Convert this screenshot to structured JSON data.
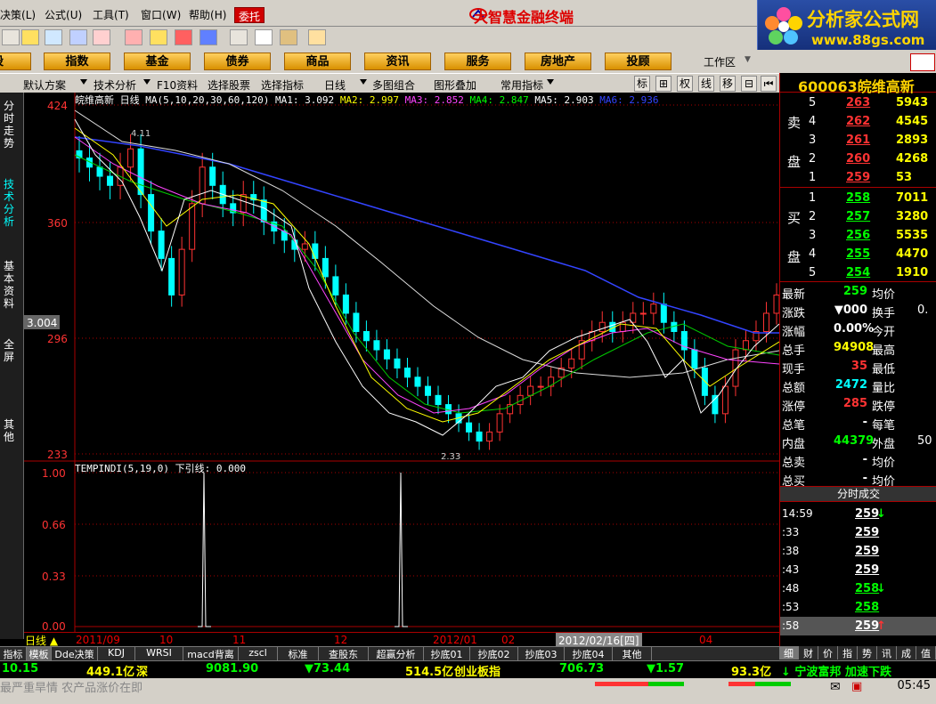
{
  "menu": {
    "items": [
      "决策",
      "公式",
      "工具",
      "窗口",
      "帮助"
    ],
    "shortcuts": [
      "(L)",
      "(U)",
      "(T)",
      "(W)",
      "(H)"
    ],
    "entrust": "委托",
    "app_title": "大智慧金融终端"
  },
  "brand": {
    "name": "分析家公式网",
    "url": "www.88gs.com"
  },
  "categories": [
    "股",
    "指数",
    "基金",
    "债券",
    "商品",
    "资讯",
    "服务",
    "房地产",
    "投顾"
  ],
  "workspace": "工作区",
  "chartbar": {
    "items": [
      "默认方案",
      "技术分析",
      "F10资料",
      "选择股票",
      "选择指标",
      "日线",
      "多图组合",
      "图形叠加",
      "常用指标"
    ],
    "buttons": [
      "标",
      "⊞",
      "权",
      "线",
      "移",
      "⊟",
      "⏮"
    ]
  },
  "sidetabs": [
    "分时走势",
    "技术分析",
    "基本资料",
    "全屏",
    "其他"
  ],
  "stock": {
    "code": "600063",
    "name": "皖维高新"
  },
  "kinfo": {
    "name": "皖维高新",
    "period": "日线",
    "ma": "MA(5,10,20,30,60,120)",
    "ma1": "MA1: 3.092",
    "ma2": "MA2: 2.997",
    "ma3": "MA3: 2.852",
    "ma4": "MA4: 2.847",
    "ma5": "MA5: 2.903",
    "ma6": "MA6: 2.936"
  },
  "colors": {
    "ma1": "#ffffff",
    "ma2": "#ffff00",
    "ma3": "#ff44ff",
    "ma4": "#00ff00",
    "ma5": "#ffffff",
    "ma6": "#3344ff",
    "up": "#ff3333",
    "down": "#00ffff",
    "grid": "#aa0000",
    "axis_label": "#ff3333"
  },
  "price_axis": {
    "labels": [
      "424",
      "360",
      "296",
      "233"
    ],
    "cursor_price": "3.004",
    "high_mark": "4.11",
    "low_mark": "2.33"
  },
  "indicator": {
    "title": "TEMPINDI(5,19,0)",
    "value": "下引线: 0.000",
    "axis_labels": [
      "1.00",
      "0.66",
      "0.33",
      "0.00"
    ]
  },
  "time_axis": {
    "period_label": "日线",
    "labels": [
      "2011/09",
      "10",
      "11",
      "12",
      "2012/01",
      "02",
      "04"
    ],
    "cursor_date": "2012/02/16[四]"
  },
  "indtabs": [
    "指标",
    "模板",
    "Dde决策",
    "KDJ",
    "WRSI",
    "macd背离",
    "zscl",
    "标准",
    "查股东",
    "超赢分析",
    "抄底01",
    "抄底02",
    "抄底03",
    "抄底04",
    "其他"
  ],
  "orderbook": {
    "sell": [
      {
        "lvl": "5",
        "price": "263",
        "vol": "5943"
      },
      {
        "lvl": "4",
        "price": "262",
        "vol": "4545"
      },
      {
        "lvl": "3",
        "price": "261",
        "vol": "2893"
      },
      {
        "lvl": "2",
        "price": "260",
        "vol": "4268"
      },
      {
        "lvl": "1",
        "price": "259",
        "vol": "53"
      }
    ],
    "buy": [
      {
        "lvl": "1",
        "price": "258",
        "vol": "7011"
      },
      {
        "lvl": "2",
        "price": "257",
        "vol": "3280"
      },
      {
        "lvl": "3",
        "price": "256",
        "vol": "5535"
      },
      {
        "lvl": "4",
        "price": "255",
        "vol": "4470"
      },
      {
        "lvl": "5",
        "price": "254",
        "vol": "1910"
      }
    ],
    "sell_label": [
      "卖",
      "盘"
    ],
    "buy_label": [
      "买",
      "盘"
    ]
  },
  "quote": [
    {
      "l": "最新",
      "v": "259",
      "r": "均价",
      "rv": ""
    },
    {
      "l": "涨跌",
      "v": "▼000",
      "r": "换手",
      "rv": "0."
    },
    {
      "l": "涨幅",
      "v": "0.00%",
      "r": "今开",
      "rv": ""
    },
    {
      "l": "总手",
      "v": "94908",
      "r": "最高",
      "rv": ""
    },
    {
      "l": "现手",
      "v": "35",
      "r": "最低",
      "rv": ""
    },
    {
      "l": "总额",
      "v": "2472",
      "r": "量比",
      "rv": ""
    },
    {
      "l": "涨停",
      "v": "285",
      "r": "跌停",
      "rv": ""
    },
    {
      "l": "总笔",
      "v": "-",
      "r": "每笔",
      "rv": ""
    },
    {
      "l": "内盘",
      "v": "44379",
      "r": "外盘",
      "rv": "50"
    },
    {
      "l": "总卖",
      "v": "-",
      "r": "均价",
      "rv": ""
    },
    {
      "l": "总买",
      "v": "-",
      "r": "均价",
      "rv": ""
    }
  ],
  "ticks_title": "分时成交",
  "ticks": [
    {
      "t": "14:59",
      "p": "259",
      "a": "↓"
    },
    {
      "t": ":33",
      "p": "259",
      "a": ""
    },
    {
      "t": ":38",
      "p": "259",
      "a": ""
    },
    {
      "t": ":43",
      "p": "259",
      "a": ""
    },
    {
      "t": ":48",
      "p": "258",
      "a": "↓"
    },
    {
      "t": ":53",
      "p": "258",
      "a": ""
    },
    {
      "t": ":58",
      "p": "259",
      "a": "↑"
    }
  ],
  "rtabs": [
    "细",
    "财",
    "价",
    "指",
    "势",
    "讯",
    "成",
    "值"
  ],
  "ticker": {
    "v1": "10.15",
    "v2": "449.1亿",
    "v2b": "深",
    "v3": "9081.90",
    "v4": "▼73.44",
    "v5": "514.5亿",
    "v5b": "创业板指",
    "v6": "706.73",
    "v7": "▼1.57",
    "v8": "93.3亿",
    "v9": "↓ 宁波富邦 加速下跌"
  },
  "status": {
    "news": "最严重旱情 农产品涨价在即",
    "time": "05:45"
  },
  "chart_data": {
    "type": "candlestick",
    "price_range": [
      2.33,
      4.24
    ],
    "mas": [
      {
        "name": "MA1",
        "last": 3.092
      },
      {
        "name": "MA2",
        "last": 2.997
      },
      {
        "name": "MA3",
        "last": 2.852
      },
      {
        "name": "MA4",
        "last": 2.847
      },
      {
        "name": "MA5",
        "last": 2.903
      },
      {
        "name": "MA6",
        "last": 2.936
      }
    ],
    "ohlc_closes": [
      3.95,
      3.9,
      3.85,
      3.8,
      3.9,
      4.0,
      3.75,
      3.55,
      3.4,
      3.2,
      3.45,
      3.7,
      3.9,
      3.8,
      3.7,
      3.65,
      3.75,
      3.72,
      3.6,
      3.55,
      3.5,
      3.45,
      3.48,
      3.4,
      3.3,
      3.2,
      3.1,
      3.0,
      2.95,
      2.9,
      2.85,
      2.8,
      2.75,
      2.7,
      2.65,
      2.6,
      2.55,
      2.5,
      2.45,
      2.4,
      2.45,
      2.55,
      2.6,
      2.65,
      2.7,
      2.7,
      2.75,
      2.8,
      2.85,
      2.95,
      3.0,
      3.05,
      3.0,
      3.05,
      3.1,
      3.1,
      3.15,
      3.05,
      3.0,
      2.9,
      2.8,
      2.65,
      2.55,
      2.7,
      2.9,
      2.95,
      3.0,
      3.1,
      3.2
    ],
    "indicator": {
      "name": "TEMPINDI(5,19,0)",
      "spikes": [
        1.0,
        1.0
      ],
      "ylim": [
        0,
        1
      ]
    }
  }
}
